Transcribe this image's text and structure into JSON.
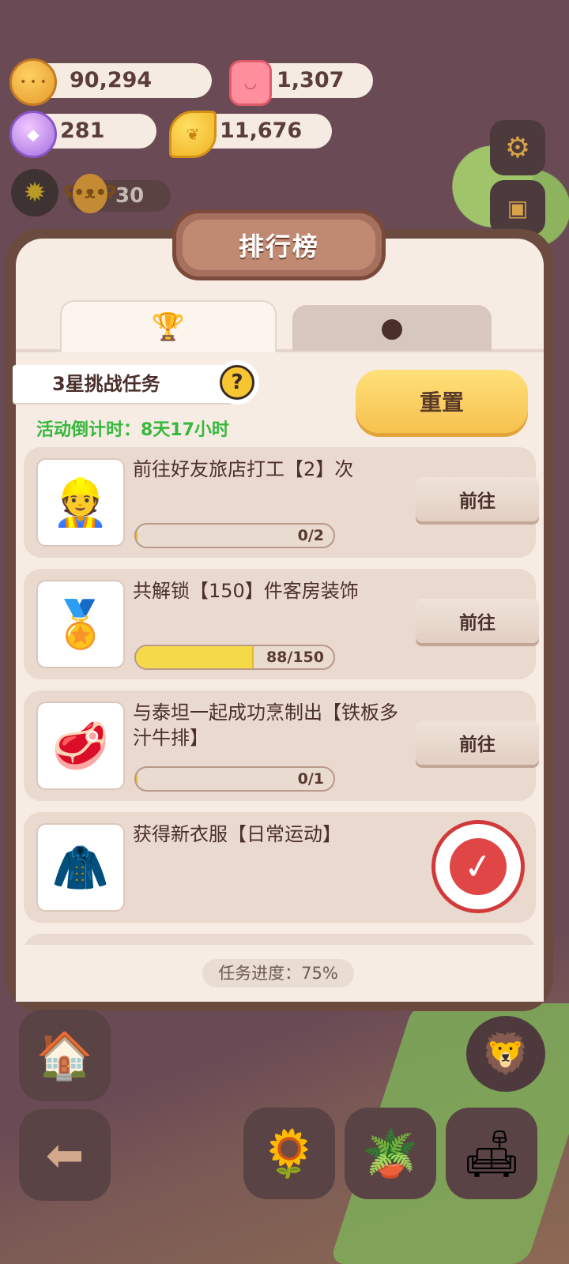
{
  "currencies": {
    "cookies": "90,294",
    "candles": "1,307",
    "gems": "281",
    "leaves": "11,676"
  },
  "level": "30",
  "panel": {
    "title": "排行榜",
    "tabs": [
      "trophy-icon",
      "cookie-planet-icon"
    ],
    "challenge_label": "3星挑战任务",
    "help_symbol": "?",
    "countdown": "活动倒计时：8天17小时",
    "reset_label": "重置",
    "go_label": "前往",
    "tasks": [
      {
        "title": "前往好友旅店打工【2】次",
        "progress": "0/2",
        "fraction": 0,
        "icon": "worker-girl-icon",
        "completed": false
      },
      {
        "title": "共解锁【150】件客房装饰",
        "progress": "88/150",
        "fraction": 0.587,
        "icon": "badge-decor-icon",
        "completed": false
      },
      {
        "title": "与泰坦一起成功烹制出【铁板多汁牛排】",
        "progress": "0/1",
        "fraction": 0,
        "icon": "steak-dish-icon",
        "completed": false
      },
      {
        "title": "获得新衣服【日常运动】",
        "progress": "",
        "fraction": 1,
        "icon": "outfit-icon",
        "completed": true
      }
    ],
    "overall_progress": "任务进度：75%"
  },
  "colors": {
    "background": "#6a4a55",
    "panel": "#f6ece3",
    "countdown_green": "#36b83c",
    "reset_yellow": "#f6c14e",
    "stamp_red": "#d13a3a"
  }
}
